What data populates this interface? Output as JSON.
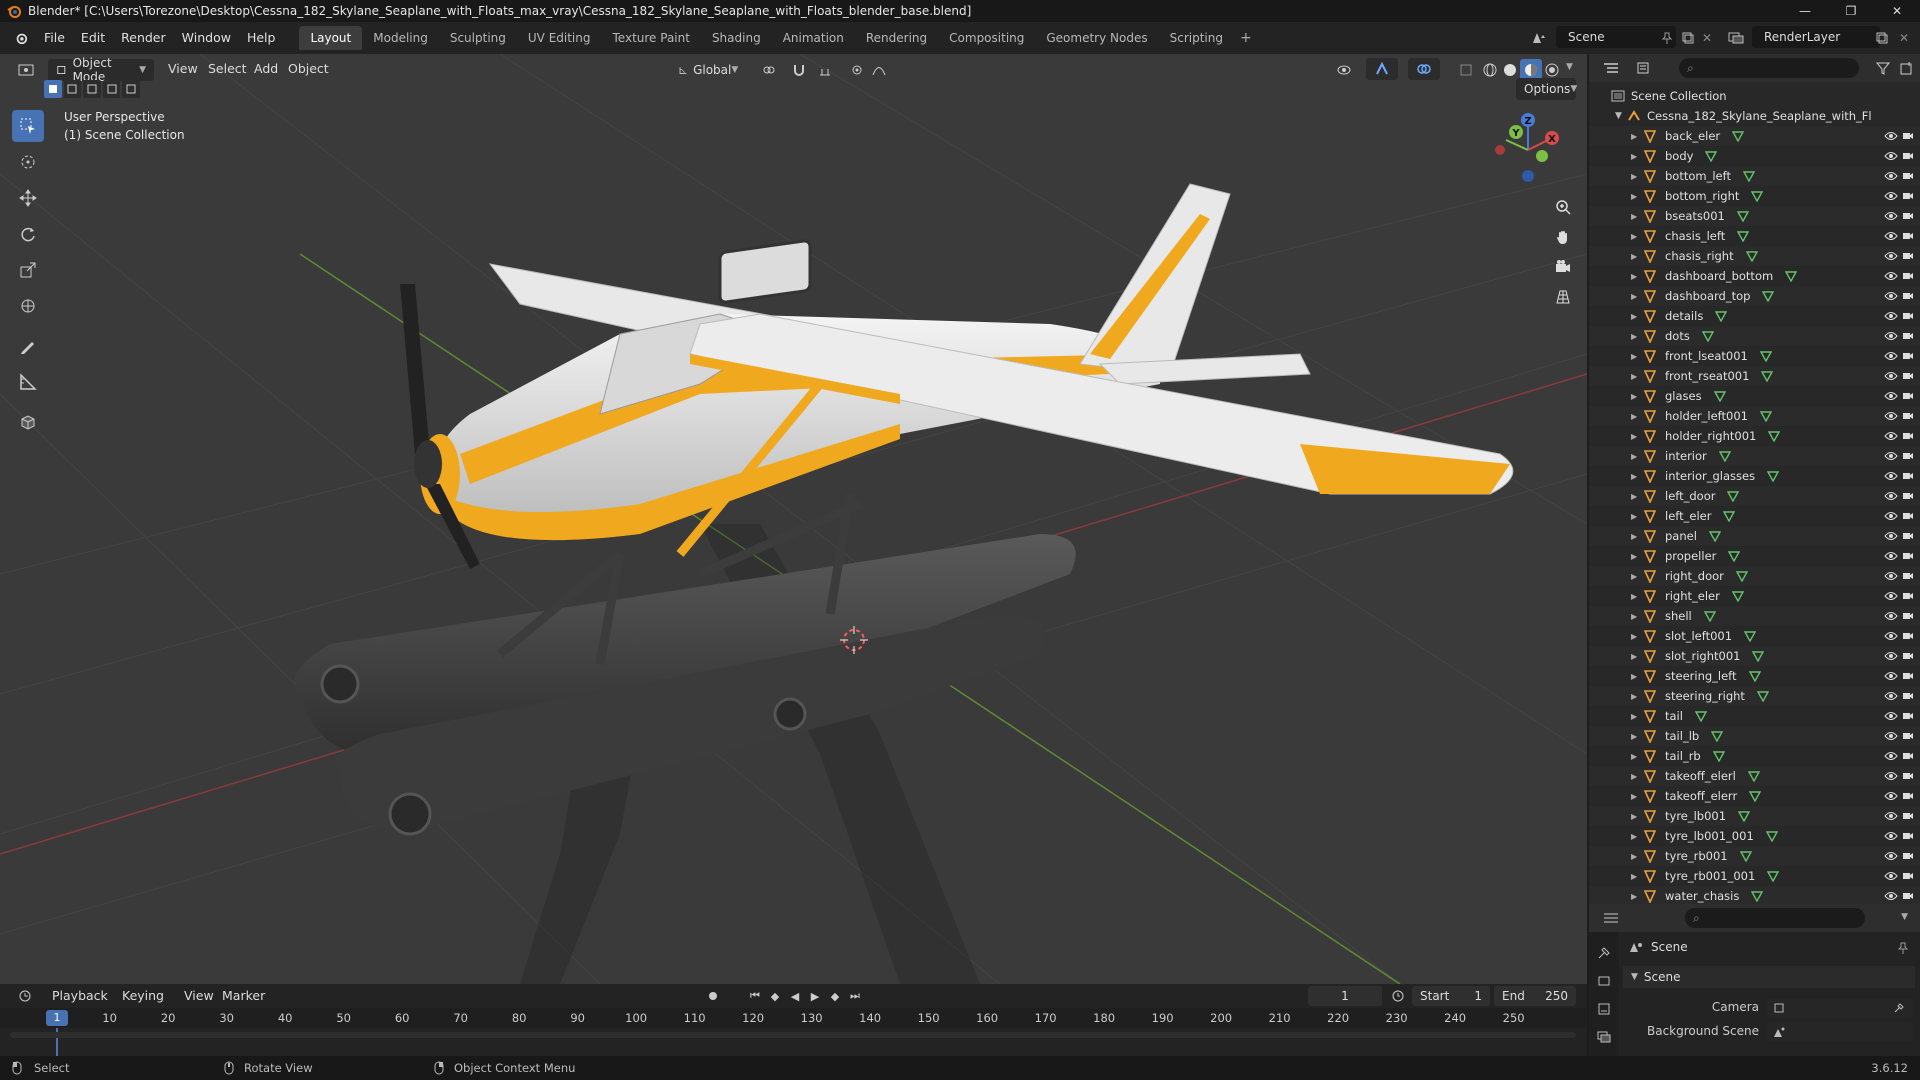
{
  "window": {
    "title": "Blender* [C:\\Users\\Torezone\\Desktop\\Cessna_182_Skylane_Seaplane_with_Floats_max_vray\\Cessna_182_Skylane_Seaplane_with_Floats_blender_base.blend]",
    "min": "—",
    "max": "❐",
    "close": "✕"
  },
  "menu": [
    "File",
    "Edit",
    "Render",
    "Window",
    "Help"
  ],
  "workspaces": [
    {
      "label": "Layout",
      "active": true
    },
    {
      "label": "Modeling"
    },
    {
      "label": "Sculpting"
    },
    {
      "label": "UV Editing"
    },
    {
      "label": "Texture Paint"
    },
    {
      "label": "Shading"
    },
    {
      "label": "Animation"
    },
    {
      "label": "Rendering"
    },
    {
      "label": "Compositing"
    },
    {
      "label": "Geometry Nodes"
    },
    {
      "label": "Scripting"
    }
  ],
  "add_workspace": "+",
  "scene": {
    "name": "Scene",
    "view_layer": "RenderLayer"
  },
  "viewport": {
    "mode": "Object Mode",
    "menus": [
      "View",
      "Select",
      "Add",
      "Object"
    ],
    "transform_orientation": "Global",
    "options_label": "Options",
    "perspective": "User Perspective",
    "collection_info": "(1) Scene Collection",
    "gizmo": {
      "x": "X",
      "y": "Y",
      "z": "Z"
    }
  },
  "outliner": {
    "root": "Scene Collection",
    "collection": "Cessna_182_Skylane_Seaplane_with_Fl",
    "objects": [
      "back_eler",
      "body",
      "bottom_left",
      "bottom_right",
      "bseats001",
      "chasis_left",
      "chasis_right",
      "dashboard_bottom",
      "dashboard_top",
      "details",
      "dots",
      "front_lseat001",
      "front_rseat001",
      "glases",
      "holder_left001",
      "holder_right001",
      "interior",
      "interior_glasses",
      "left_door",
      "left_eler",
      "panel",
      "propeller",
      "right_door",
      "right_eler",
      "shell",
      "slot_left001",
      "slot_right001",
      "steering_left",
      "steering_right",
      "tail",
      "tail_lb",
      "tail_rb",
      "takeoff_elerl",
      "takeoff_elerr",
      "tyre_lb001",
      "tyre_lb001_001",
      "tyre_rb001",
      "tyre_rb001_001",
      "water_chasis"
    ]
  },
  "properties": {
    "context": "Scene",
    "panel": "Scene",
    "camera_label": "Camera",
    "background_scene_label": "Background Scene"
  },
  "timeline": {
    "menus": [
      "Playback",
      "Keying",
      "View",
      "Marker"
    ],
    "current_frame": "1",
    "start_label": "Start",
    "start": "1",
    "end_label": "End",
    "end": "250",
    "ticks": [
      "1",
      "10",
      "20",
      "30",
      "40",
      "50",
      "60",
      "70",
      "80",
      "90",
      "100",
      "110",
      "120",
      "130",
      "140",
      "150",
      "160",
      "170",
      "180",
      "190",
      "200",
      "210",
      "220",
      "230",
      "240",
      "250"
    ]
  },
  "status": {
    "select": "Select",
    "rotate": "Rotate View",
    "context_menu": "Object Context Menu",
    "version": "3.6.12"
  },
  "colors": {
    "accent": "#4772b3",
    "plane_yellow": "#f0a81e",
    "plane_white": "#e8e8e8",
    "float_gray": "#4a4a4a"
  }
}
